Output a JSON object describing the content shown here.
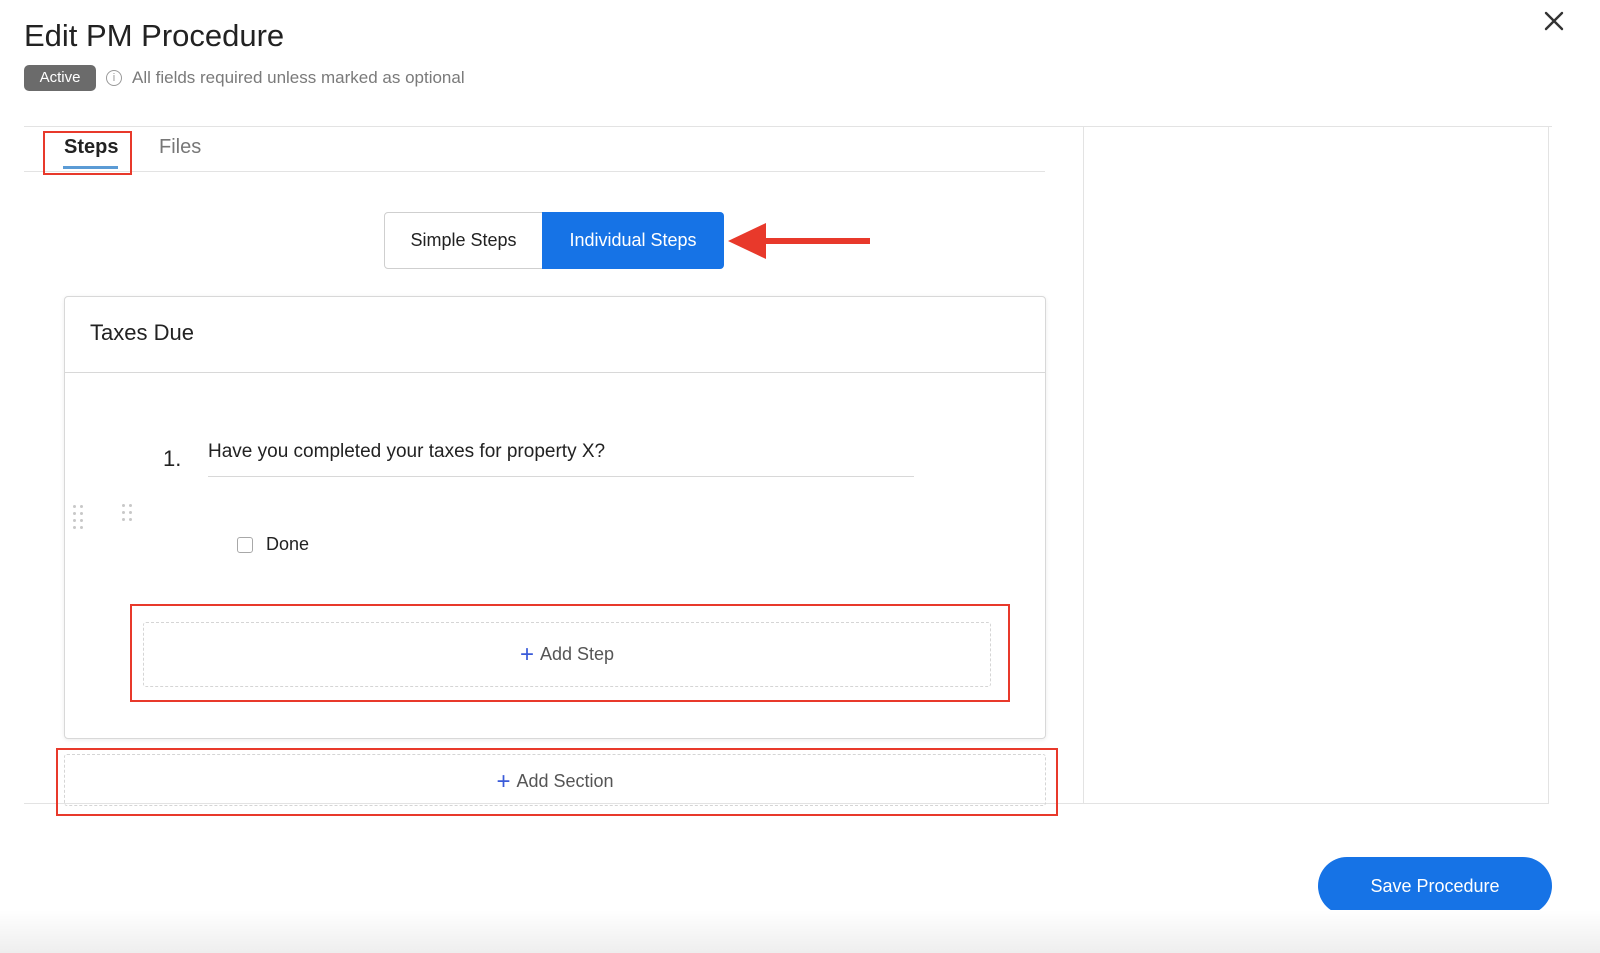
{
  "header": {
    "title": "Edit PM Procedure",
    "status_badge": "Active",
    "required_note": "All fields required unless marked as optional",
    "info_icon_glyph": "i"
  },
  "tabs": [
    {
      "label": "Steps",
      "active": true
    },
    {
      "label": "Files",
      "active": false
    }
  ],
  "step_mode": {
    "options": [
      "Simple Steps",
      "Individual Steps"
    ],
    "selected": "Individual Steps"
  },
  "section": {
    "title": "Taxes Due",
    "steps": [
      {
        "number": "1.",
        "text": "Have you completed your taxes for property X?",
        "checkbox_label": "Done",
        "checked": false
      }
    ],
    "add_step_label": "Add Step"
  },
  "add_section_label": "Add Section",
  "plus_glyph": "+",
  "footer": {
    "save_label": "Save Procedure"
  },
  "colors": {
    "primary": "#1673e6",
    "annotation_red": "#e8392b",
    "tab_underline": "#5b9bd5",
    "badge_gray": "#6b6b6b"
  },
  "icons": {
    "close": "close-icon",
    "info": "info-icon",
    "plus": "plus-icon",
    "drag": "drag-handle-icon"
  }
}
